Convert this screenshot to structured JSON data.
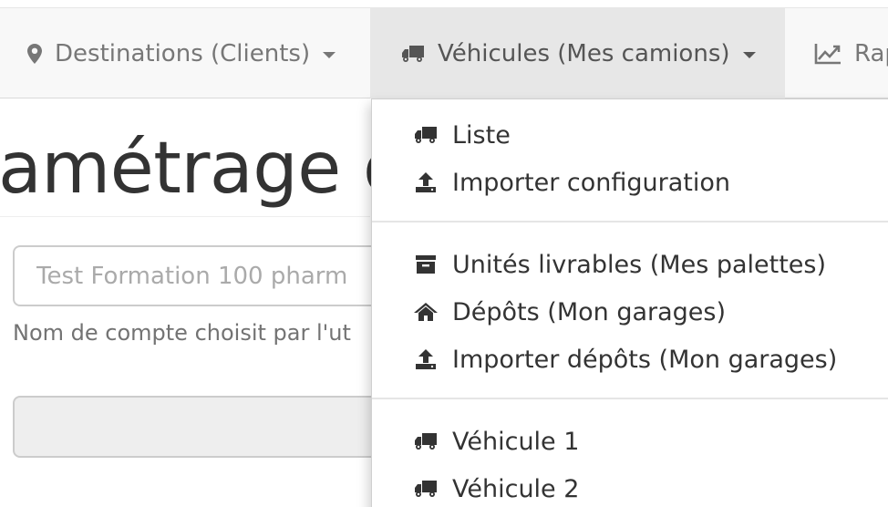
{
  "navbar": {
    "items": [
      {
        "label": "Destinations (Clients)",
        "icon": "map-marker-icon",
        "active": false
      },
      {
        "label": "Véhicules (Mes camions)",
        "icon": "truck-icon",
        "active": true
      },
      {
        "label": "Rap",
        "icon": "line-chart-icon",
        "active": false
      }
    ]
  },
  "main": {
    "title": "amétrage g",
    "account_input": {
      "value": "",
      "placeholder": "Test Formation 100 pharm"
    },
    "help_text": "Nom de compte choisit par l'ut"
  },
  "dropdown": {
    "groups": [
      [
        {
          "label": "Liste",
          "icon": "truck-icon"
        },
        {
          "label": "Importer configuration",
          "icon": "upload-icon"
        }
      ],
      [
        {
          "label": "Unités livrables (Mes palettes)",
          "icon": "archive-icon"
        },
        {
          "label": "Dépôts (Mon garages)",
          "icon": "home-icon"
        },
        {
          "label": "Importer dépôts (Mon garages)",
          "icon": "upload-icon"
        }
      ],
      [
        {
          "label": "Véhicule 1",
          "icon": "truck-icon"
        },
        {
          "label": "Véhicule 2",
          "icon": "truck-icon"
        }
      ]
    ]
  }
}
